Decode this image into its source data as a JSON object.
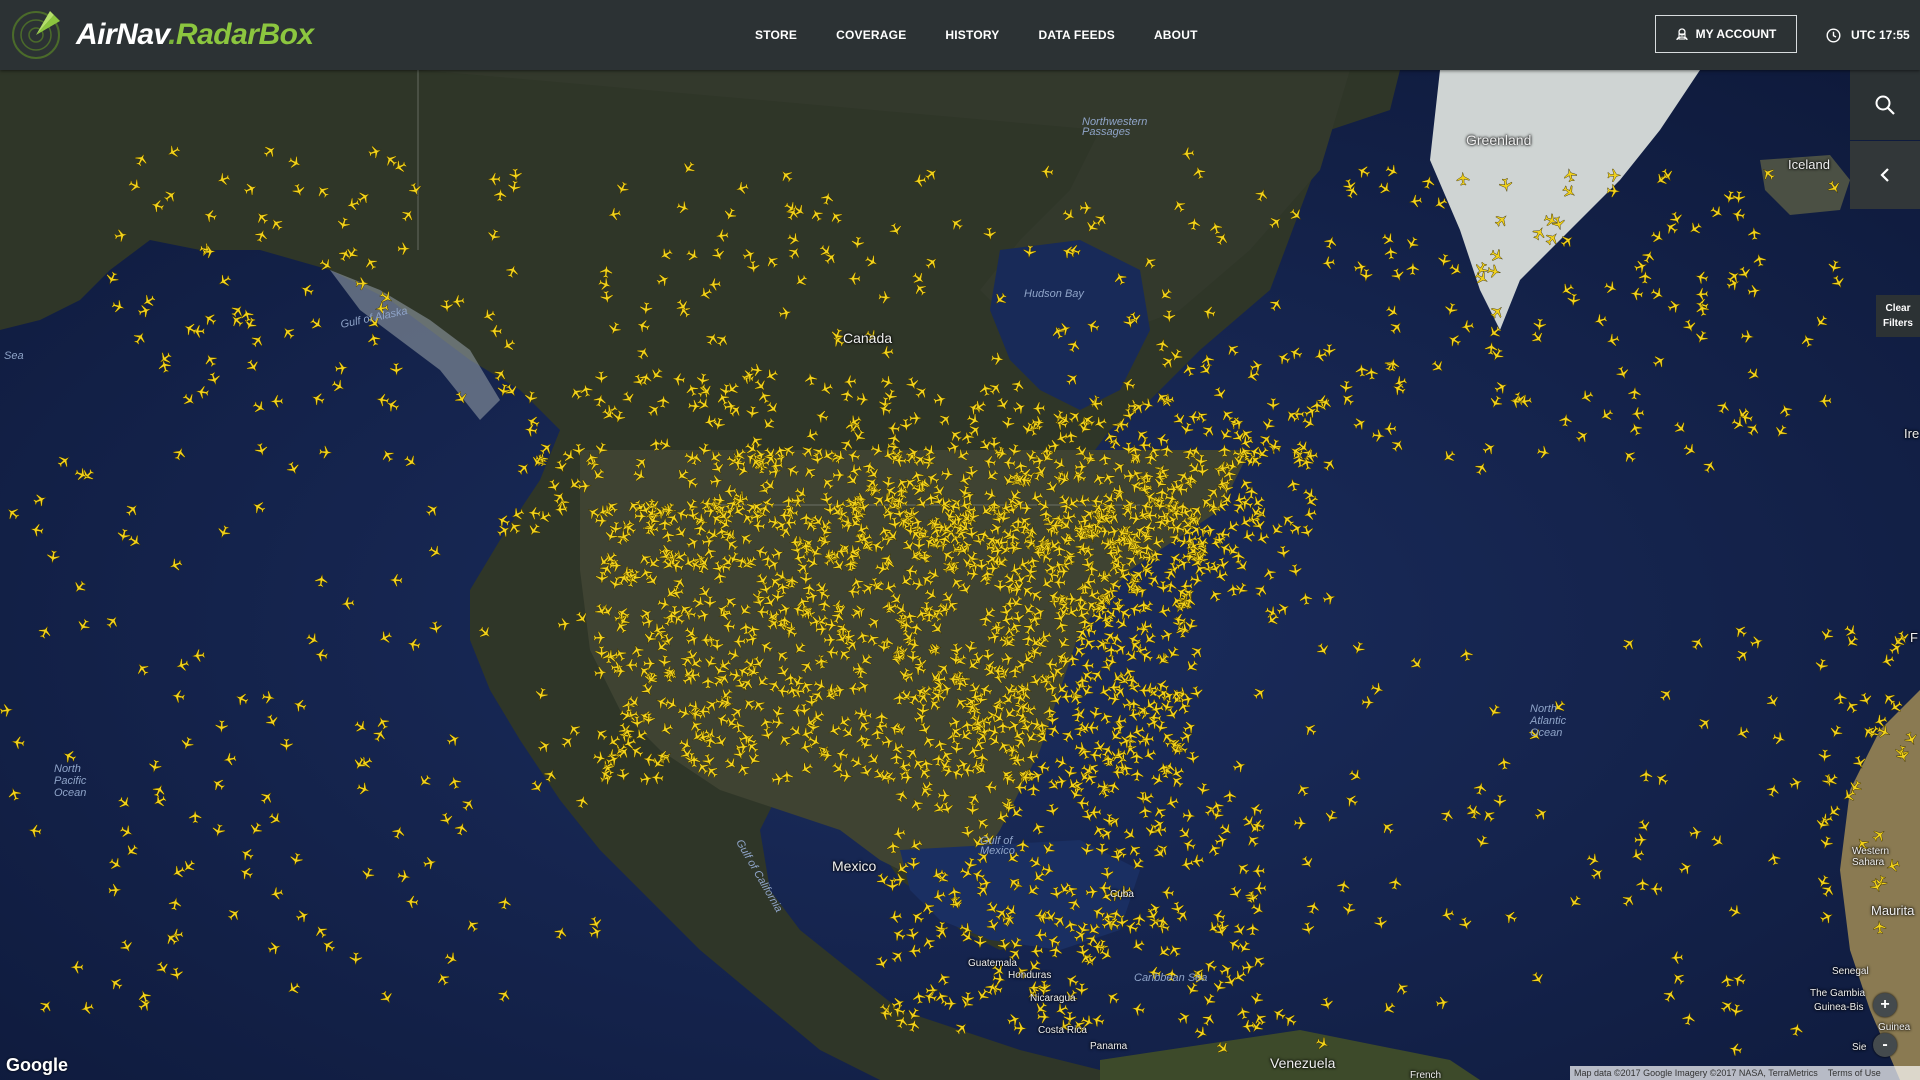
{
  "brand": {
    "airnav": "AirNav",
    "dot": ".",
    "radarbox": "RadarBox"
  },
  "nav": [
    {
      "label": "STORE"
    },
    {
      "label": "COVERAGE"
    },
    {
      "label": "HISTORY"
    },
    {
      "label": "DATA FEEDS"
    },
    {
      "label": "ABOUT"
    }
  ],
  "account": {
    "label": "MY ACCOUNT",
    "icon": "user-icon"
  },
  "clock": {
    "label": "UTC 17:55",
    "icon": "clock-icon"
  },
  "controls": {
    "search_icon": "search-icon",
    "collapse_icon": "chevron-left-icon",
    "clear_filters_line1": "Clear",
    "clear_filters_line2": "Filters",
    "zoom_in": "+",
    "zoom_out": "-"
  },
  "map_labels": {
    "greenland": "Greenland",
    "iceland": "Iceland",
    "canada": "Canada",
    "hudson_bay": "Hudson Bay",
    "northwestern_passages": "Northwestern\nPassages",
    "gulf_of_alaska": "Gulf of Alaska",
    "sea": "Sea",
    "north_pacific_ocean": "North\nPacific\nOcean",
    "north_atlantic_ocean": "North\nAtlantic\nOcean",
    "mexico": "Mexico",
    "gulf_of_mexico": "Gulf of\nMexico",
    "gulf_of_california": "Gulf of California",
    "cuba": "Cuba",
    "guatemala": "Guatemala",
    "honduras": "Honduras",
    "nicaragua": "Nicaragua",
    "costa_rica": "Costa Rica",
    "panama": "Panama",
    "caribbean_sea": "Caribbean Sea",
    "venezuela": "Venezuela",
    "western_sahara": "Western\nSahara",
    "mauritania": "Maurita",
    "senegal": "Senegal",
    "gambia": "The Gambia",
    "guinea_bissau": "Guinea-Bis",
    "guinea": "Guinea",
    "sierra_leone": "Sie    one",
    "ireland": "Ire",
    "french": "French",
    "fr": "F"
  },
  "footer": {
    "google": "Google",
    "attribution": "Map data ©2017 Google Imagery ©2017 NASA, TerraMetrics",
    "terms": "Terms of Use"
  },
  "colors": {
    "header_bg": "#2c3234",
    "brand_green": "#8cc63f",
    "plane_yellow": "#f2d21b",
    "ocean": "#14214a",
    "land": "#3a3f2c"
  }
}
